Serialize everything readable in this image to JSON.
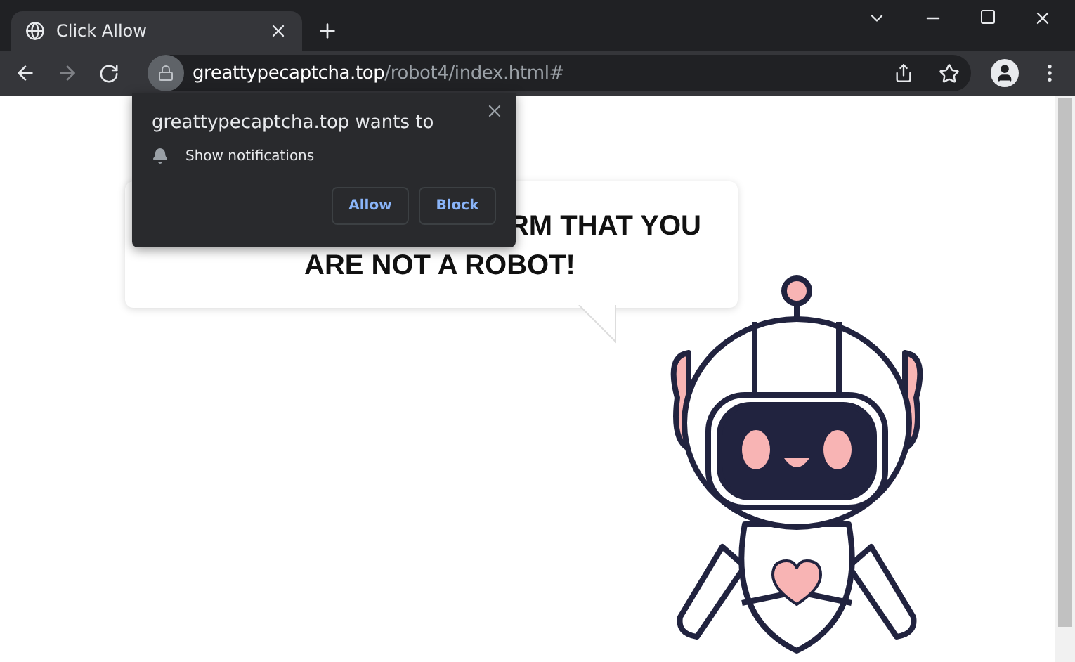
{
  "tab": {
    "title": "Click Allow",
    "selected": true
  },
  "address": {
    "host": "greattypecaptcha.top",
    "path": "/robot4/index.html#"
  },
  "permission_popup": {
    "title": "greattypecaptcha.top wants to",
    "permission": "Show notifications",
    "buttons": [
      "Allow",
      "Block"
    ]
  },
  "page": {
    "headline_lines": [
      "RM THAT YOU",
      "ARE NOT A ROBOT!"
    ]
  }
}
